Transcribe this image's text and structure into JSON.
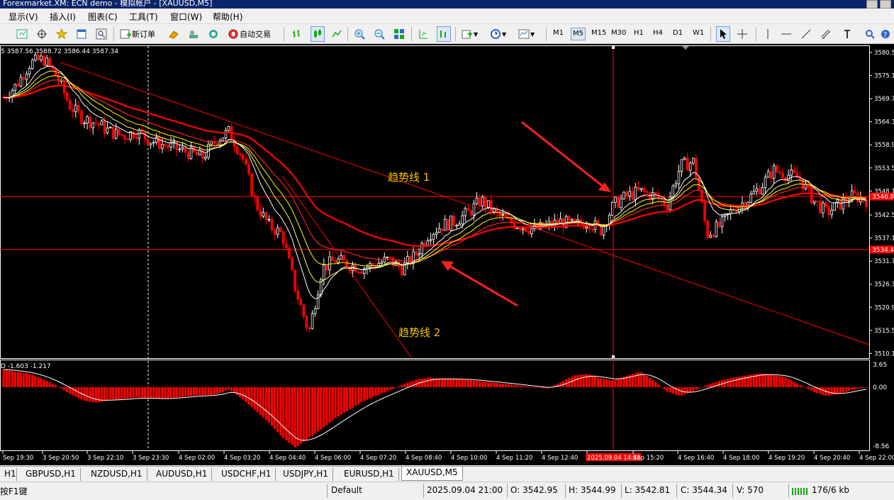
{
  "window": {
    "title": "Forexmarket.XM: ECN demo - 模拟帐户 - [XAUUSD,M5]"
  },
  "menu": [
    "显示(V)",
    "插入(I)",
    "图表(C)",
    "工具(T)",
    "窗口(W)",
    "帮助(H)"
  ],
  "toolbar": {
    "new_order": "新订单",
    "auto_trading": "自动交易",
    "timeframes": [
      "M1",
      "M5",
      "M15",
      "M30",
      "H1",
      "H4",
      "D1",
      "W1"
    ],
    "active_timeframe": "M5"
  },
  "chart": {
    "ohlc_header": "5  3587.56 3588.72 3586.44 3587.34",
    "price_labels": [
      "3580.5",
      "3575.1",
      "3569.7",
      "3564.3",
      "3558.9",
      "3553.5",
      "3548.1",
      "3542.5",
      "3537.1",
      "3531.7",
      "3526.3",
      "3520.9",
      "3515.5",
      "3510.1"
    ],
    "price_ticks": [
      3580.5,
      3575.1,
      3569.7,
      3564.3,
      3558.9,
      3553.5,
      3548.1,
      3542.5,
      3537.1,
      3531.7,
      3526.3,
      3520.9,
      3515.5,
      3510.1
    ],
    "price_range": [
      3509.0,
      3582.0
    ],
    "hline_upper": 3546.8,
    "hline_lower": 3534.4,
    "hline_upper_label": "3546.8",
    "hline_lower_label": "3534.4",
    "trendline_1": "趋势线 1",
    "trendline_2": "趋势线 2",
    "crosshair_time": "2025.09.04 14:45",
    "time_labels": [
      "Sep 19:30",
      "3 Sep 20:50",
      "3 Sep 22:10",
      "3 Sep 23:30",
      "4 Sep 02:00",
      "4 Sep 03:20",
      "4 Sep 04:40",
      "4 Sep 06:00",
      "4 Sep 07:20",
      "4 Sep 08:40",
      "4 Sep 10:00",
      "4 Sep 11:20",
      "4 Sep 12:40",
      "2025.09.04 14:45",
      "Sep 15:20",
      "4 Sep 16:40",
      "4 Sep 18:00",
      "4 Sep 19:20",
      "4 Sep 20:40",
      "4 Sep 22:00"
    ],
    "colors": {
      "bull": "#ffffff",
      "bear": "#ff0000",
      "grid": "#ffffff",
      "accent_red": "#ff0000",
      "ma_yellow": "#ffff00"
    }
  },
  "chart_data": {
    "type": "candlestick",
    "series": [
      {
        "name": "XAUUSD,M5",
        "close_path": [
          3570,
          3573,
          3578,
          3579,
          3575,
          3568,
          3565,
          3564,
          3562,
          3561,
          3562,
          3560,
          3559,
          3558,
          3557,
          3556,
          3560,
          3562,
          3556,
          3545,
          3540,
          3538,
          3525,
          3515,
          3530,
          3532,
          3531,
          3530,
          3531,
          3532,
          3530,
          3533,
          3538,
          3540,
          3541,
          3543,
          3546,
          3543,
          3541,
          3540,
          3539,
          3540,
          3541,
          3540,
          3541,
          3539,
          3545,
          3547,
          3548,
          3547,
          3545,
          3554,
          3555,
          3538,
          3540,
          3544,
          3546,
          3549,
          3553,
          3552,
          3551,
          3546,
          3543,
          3545,
          3547,
          3546
        ]
      }
    ],
    "indicator": {
      "name": "MACD",
      "header": "D -1.603 -1.217",
      "top_label": "3.65",
      "zero_label": "0.00",
      "bottom_label": "-8.56",
      "range": [
        -8.56,
        3.65
      ],
      "histogram_shape": [
        2.4,
        2.1,
        1.8,
        1.1,
        0.2,
        -0.9,
        -1.8,
        -2.1,
        -1.7,
        -1.6,
        -1.4,
        -1.5,
        -1.6,
        -1.4,
        -1.2,
        -1.1,
        -1.0,
        -0.3,
        -1.6,
        -3.2,
        -4.8,
        -6.8,
        -8.2,
        -6.9,
        -5.6,
        -4.2,
        -3.1,
        -2.0,
        -1.2,
        -0.5,
        0.3,
        1.0,
        1.3,
        1.2,
        1.1,
        1.0,
        0.8,
        0.6,
        0.4,
        0.2,
        0.0,
        -0.2,
        0.7,
        1.6,
        1.8,
        1.2,
        0.9,
        1.6,
        2.1,
        0.9,
        -0.6,
        -1.2,
        -0.5,
        0.3,
        0.9,
        1.3,
        1.6,
        1.9,
        1.7,
        1.3,
        0.3,
        -0.6,
        -1.2,
        -0.9,
        -0.3,
        0.0
      ]
    }
  },
  "tabs": [
    "H1",
    "GBPUSD,H1",
    "NZDUSD,H1",
    "AUDUSD,H1",
    "USDCHF,H1",
    "USDJPY,H1",
    "EURUSD,H1",
    "XAUUSD,M5"
  ],
  "active_tab": "XAUUSD,M5",
  "status": {
    "help": "按F1键",
    "profile": "Default",
    "datetime": "2025.09.04 21:00",
    "open": "O: 3542.95",
    "high": "H: 3544.99",
    "low": "L: 3542.81",
    "close": "C: 3544.34",
    "volume": "V: 570",
    "traffic": "176/6 kb"
  }
}
